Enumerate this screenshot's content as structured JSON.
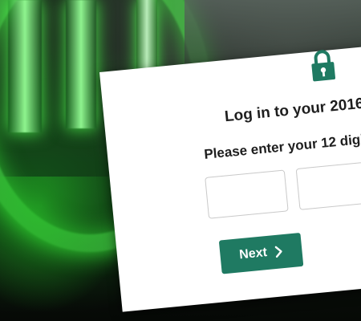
{
  "dialog": {
    "title": "Log in to your 2016",
    "instruction": "Please enter your 12 digit",
    "inputs": [
      {
        "value": "",
        "placeholder": ""
      },
      {
        "value": "",
        "placeholder": ""
      }
    ],
    "next_label": "Next",
    "icons": {
      "lock": "lock-icon",
      "next": "chevron-right-icon"
    }
  },
  "colors": {
    "accent": "#1f7a62",
    "card_background": "#ffffff",
    "text": "#1e1e1e",
    "background_glow": "#3cff3c"
  }
}
